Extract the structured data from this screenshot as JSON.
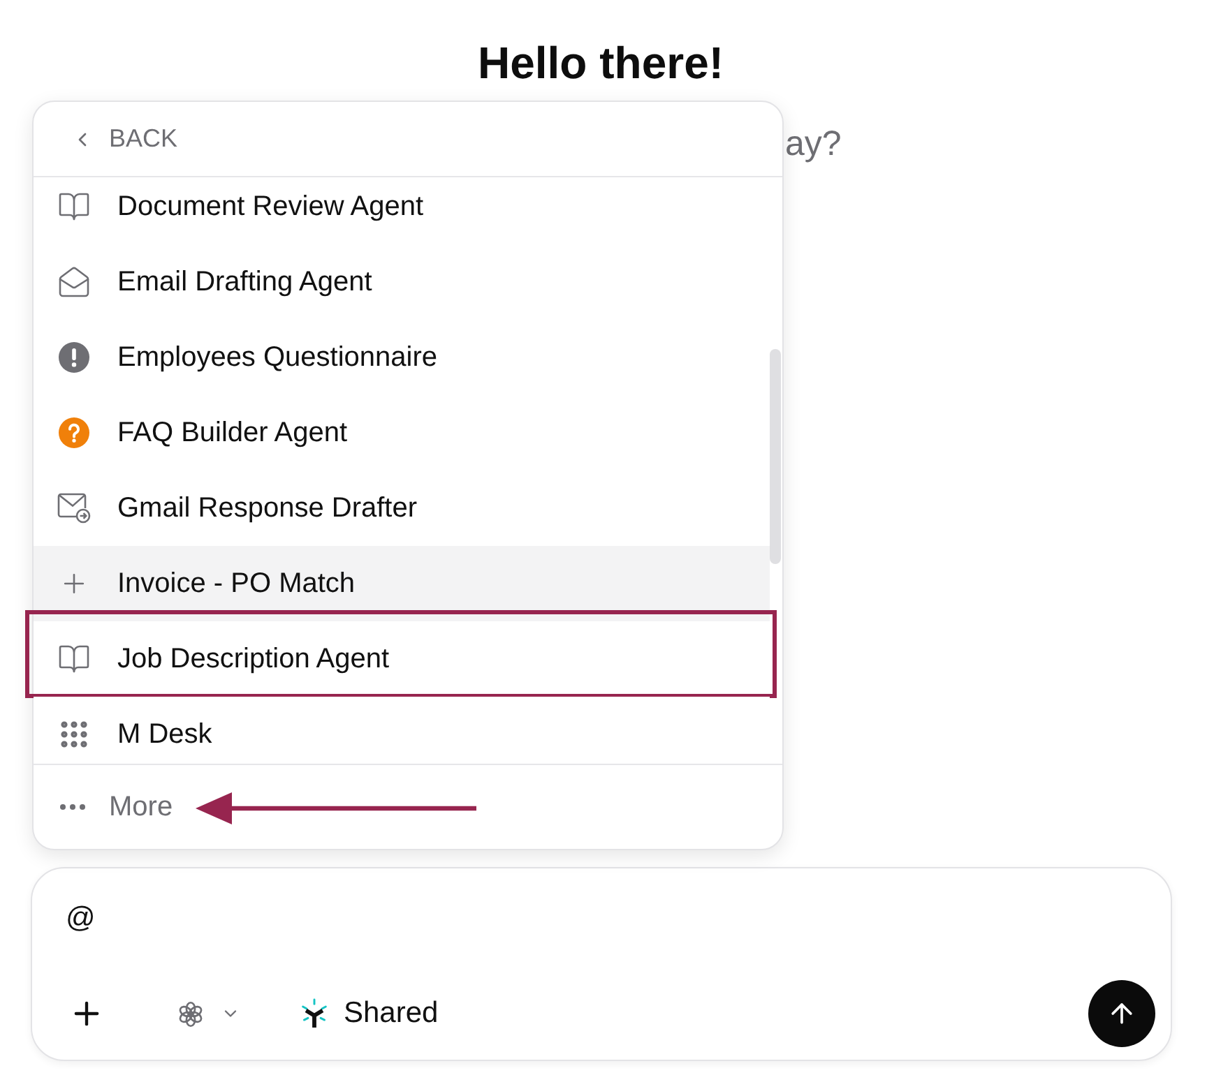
{
  "heading": {
    "title": "Hello there!",
    "subtitle": "ay?"
  },
  "menu": {
    "back": "BACK",
    "items": [
      {
        "label": "Document Review Agent",
        "selected": false,
        "outlined": false
      },
      {
        "label": "Email Drafting Agent",
        "selected": false,
        "outlined": false
      },
      {
        "label": "Employees Questionnaire",
        "selected": false,
        "outlined": false
      },
      {
        "label": "FAQ Builder Agent",
        "selected": false,
        "outlined": false
      },
      {
        "label": "Gmail Response Drafter",
        "selected": false,
        "outlined": false
      },
      {
        "label": "Invoice - PO Match",
        "selected": true,
        "outlined": false
      },
      {
        "label": "Job Description Agent",
        "selected": false,
        "outlined": true
      },
      {
        "label": "M Desk",
        "selected": false,
        "outlined": false
      }
    ],
    "more": {
      "label": "More",
      "arrow": true
    }
  },
  "composer": {
    "value": "@",
    "shared": "Shared"
  }
}
